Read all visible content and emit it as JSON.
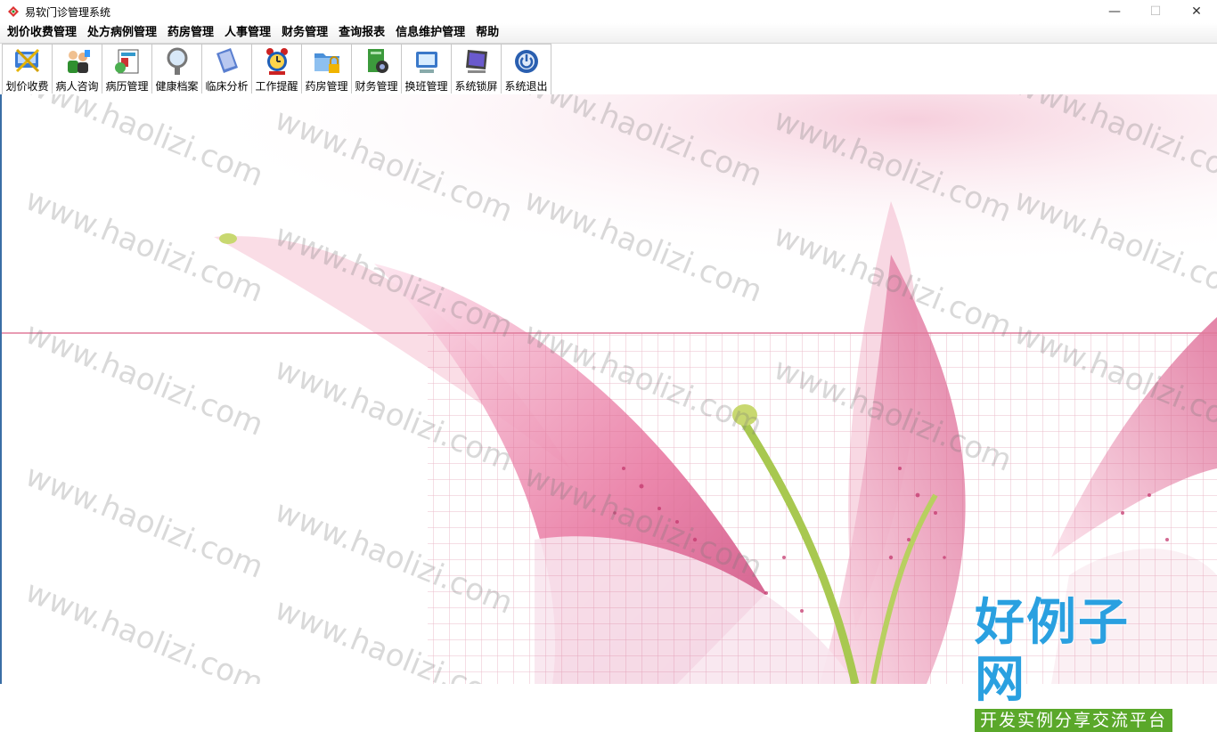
{
  "window": {
    "title": "易软门诊管理系统",
    "controls": {
      "minimize": "—",
      "maximize": "☐",
      "close": "✕"
    }
  },
  "menu": [
    "划价收费管理",
    "处方病例管理",
    "药房管理",
    "人事管理",
    "财务管理",
    "查询报表",
    "信息维护管理",
    "帮助"
  ],
  "toolbar": [
    {
      "label": "划价收费",
      "icon": "billing-icon",
      "color": "#3a7bd5"
    },
    {
      "label": "病人咨询",
      "icon": "patients-icon",
      "color": "#2f8f2f"
    },
    {
      "label": "病历管理",
      "icon": "medical-records-icon",
      "color": "#3399cc"
    },
    {
      "label": "健康档案",
      "icon": "magnifier-icon",
      "color": "#888888"
    },
    {
      "label": "临床分析",
      "icon": "book-icon",
      "color": "#5a7fd0"
    },
    {
      "label": "工作提醒",
      "icon": "alarm-clock-icon",
      "color": "#cc2222"
    },
    {
      "label": "药房管理",
      "icon": "folder-lock-icon",
      "color": "#4a90d9"
    },
    {
      "label": "财务管理",
      "icon": "document-disc-icon",
      "color": "#3c9a3c"
    },
    {
      "label": "换班管理",
      "icon": "monitor-icon",
      "color": "#3a78c9"
    },
    {
      "label": "系统锁屏",
      "icon": "screen-icon",
      "color": "#6a5acd"
    },
    {
      "label": "系统退出",
      "icon": "power-icon",
      "color": "#2a5fb0"
    }
  ],
  "watermark_text": "www.haolizi.com",
  "logo": {
    "main": "好例子网",
    "sub": "开发实例分享交流平台"
  },
  "colors": {
    "accent_pink": "#e07a9a",
    "logo_blue": "#2aa0e0",
    "logo_green": "#5aa82a"
  }
}
